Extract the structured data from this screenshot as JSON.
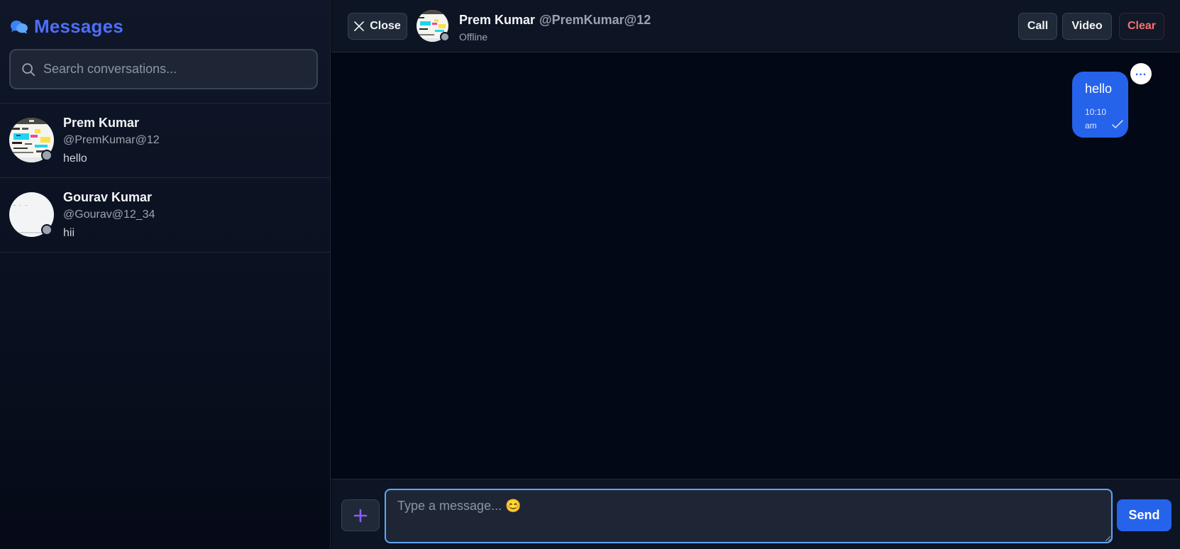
{
  "sidebar": {
    "brand_icon": "chat-bubbles-icon",
    "title": "Messages",
    "search": {
      "placeholder": "Search conversations...",
      "value": ""
    },
    "conversations": [
      {
        "name": "Prem Kumar",
        "handle": "@PremKumar@12",
        "last_message": "hello",
        "status": "offline"
      },
      {
        "name": "Gourav Kumar",
        "handle": "@Gourav@12_34",
        "last_message": "hii",
        "status": "offline"
      }
    ]
  },
  "chat": {
    "close_label": "Close",
    "contact": {
      "name": "Prem Kumar",
      "handle": "@PremKumar@12",
      "status": "Offline"
    },
    "actions": {
      "call": "Call",
      "video": "Video",
      "clear": "Clear"
    },
    "messages": [
      {
        "text": "hello",
        "time": "10:10 am",
        "sent_by_me": true,
        "delivered": true,
        "more_label": "..."
      }
    ],
    "composer": {
      "placeholder": "Type a message... 😊",
      "value": "",
      "send_label": "Send",
      "attach_icon": "plus-icon"
    }
  },
  "colors": {
    "accent": "#2563eb",
    "brand": "#4f6ef7",
    "danger": "#f87171",
    "status_offline": "#9ca3af",
    "background": "#030712"
  }
}
